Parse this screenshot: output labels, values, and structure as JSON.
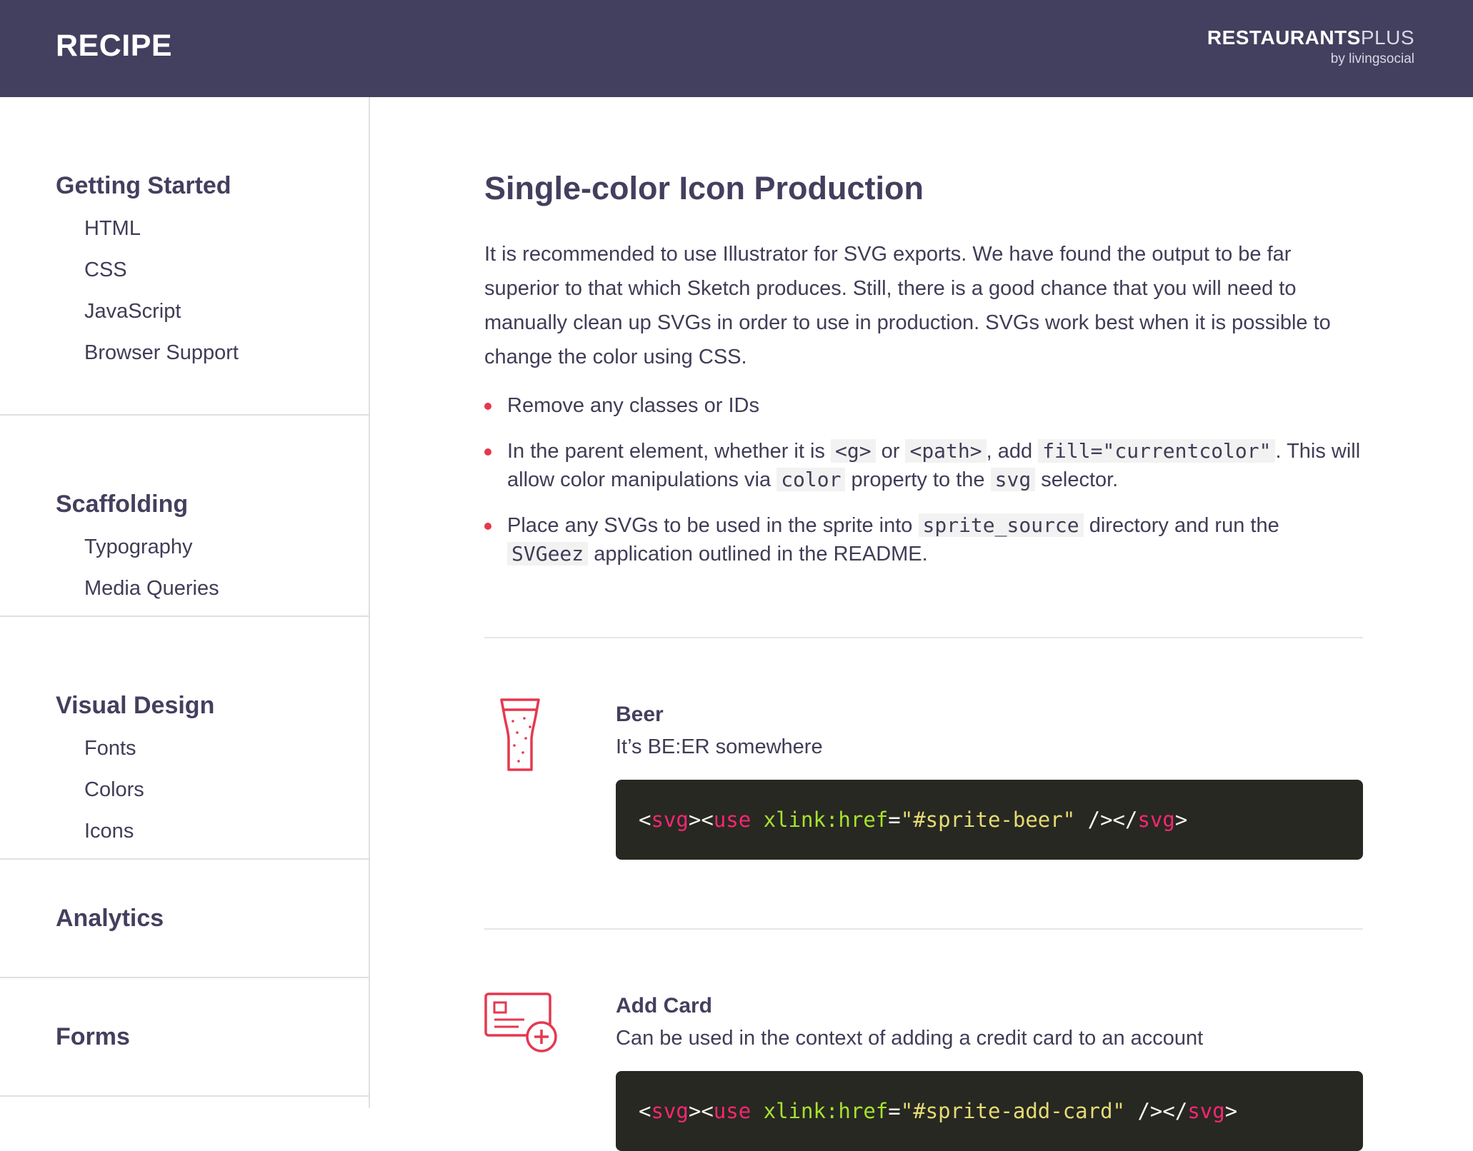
{
  "header": {
    "app_title": "RECIPE",
    "brand_primary": "RESTAURANTS",
    "brand_secondary": "PLUS",
    "brand_sub": "by livingsocial"
  },
  "sidebar": {
    "sections": [
      {
        "heading": "Getting Started",
        "items": [
          "HTML",
          "CSS",
          "JavaScript",
          "Browser Support"
        ]
      },
      {
        "heading": "Scaffolding",
        "items": [
          "Typography",
          "Media Queries"
        ]
      },
      {
        "heading": "Visual Design",
        "items": [
          "Fonts",
          "Colors",
          "Icons"
        ]
      },
      {
        "heading": "Analytics",
        "items": []
      },
      {
        "heading": "Forms",
        "items": []
      }
    ]
  },
  "main": {
    "title": "Single-color Icon Production",
    "intro": "It is recommended to use Illustrator for SVG exports. We have found the output to be far superior to that which Sketch produces. Still, there is a good chance that you will need to manually clean up SVGs in order to use in production. SVGs work best when it is possible to change the color using CSS.",
    "bullets": {
      "b1": "Remove any classes or IDs",
      "b2": {
        "t1": "In the parent element, whether it is ",
        "c1": "<g>",
        "t2": " or ",
        "c2": "<path>",
        "t3": ", add ",
        "c3": "fill=\"currentcolor\"",
        "t4": ". This will allow color manipulations via ",
        "c4": "color",
        "t5": " property to the ",
        "c5": "svg",
        "t6": " selector."
      },
      "b3": {
        "t1": "Place any SVGs to be used in the sprite into ",
        "c1": "sprite_source",
        "t2": " directory and run the ",
        "c2": "SVGeez",
        "t3": " application outlined in the README."
      }
    },
    "icons": [
      {
        "name": "Beer",
        "description": "It’s BE:ER somewhere",
        "icon": "beer-glass-icon",
        "code": {
          "lt": "<",
          "svg": "svg",
          "gt": ">",
          "use": "use",
          "attr": "xlink:href",
          "eq": "=",
          "value": "\"#sprite-beer\"",
          "close": " /></",
          "svg2": "svg",
          "end": ">"
        }
      },
      {
        "name": "Add Card",
        "description": "Can be used in the context of adding a credit card to an account",
        "icon": "add-card-icon",
        "code": {
          "lt": "<",
          "svg": "svg",
          "gt": ">",
          "use": "use",
          "attr": "xlink:href",
          "eq": "=",
          "value": "\"#sprite-add-card\"",
          "close": " /></",
          "svg2": "svg",
          "end": ">"
        }
      }
    ]
  },
  "colors": {
    "header_bg": "#433f5e",
    "accent": "#e5384f",
    "code_bg": "#272822"
  }
}
